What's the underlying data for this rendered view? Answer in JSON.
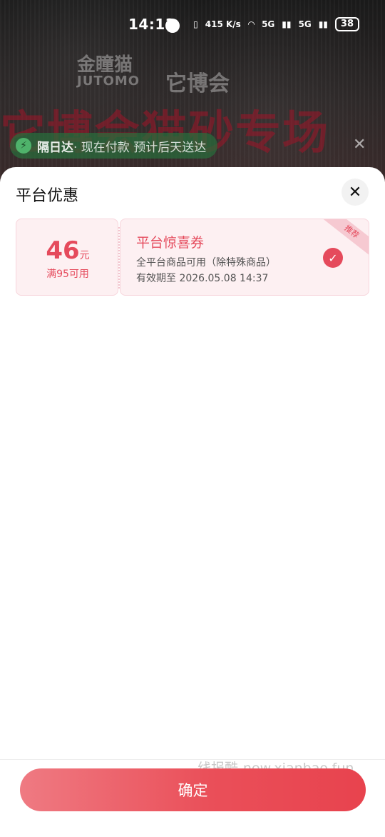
{
  "status_bar": {
    "time": "14:13",
    "network_speed": "415 K/s",
    "signal1": "5G",
    "signal2": "5G",
    "battery": "38"
  },
  "background": {
    "brand_name": "金瞳猫",
    "brand_name_en": "JUTOMO",
    "expo_name": "它博会",
    "hero_text": "它博会猫砂专场",
    "delivery_highlight": "隔日达",
    "delivery_text": " · 现在付款 预计后天送达"
  },
  "sheet": {
    "title": "平台优惠",
    "coupon": {
      "amount": "46",
      "amount_unit": "元",
      "threshold": "满95可用",
      "title": "平台惊喜券",
      "scope": "全平台商品可用（除特殊商品）",
      "expiry": "有效期至 2026.05.08 14:37",
      "ribbon": "推荐",
      "selected": true
    }
  },
  "watermark": "线报酷-new.xianbao.fun",
  "confirm_label": "确定",
  "colors": {
    "accent": "#e54a5c",
    "coupon_bg": "#fdf0f2",
    "button_start": "#ef7a82",
    "button_end": "#e8434e"
  }
}
